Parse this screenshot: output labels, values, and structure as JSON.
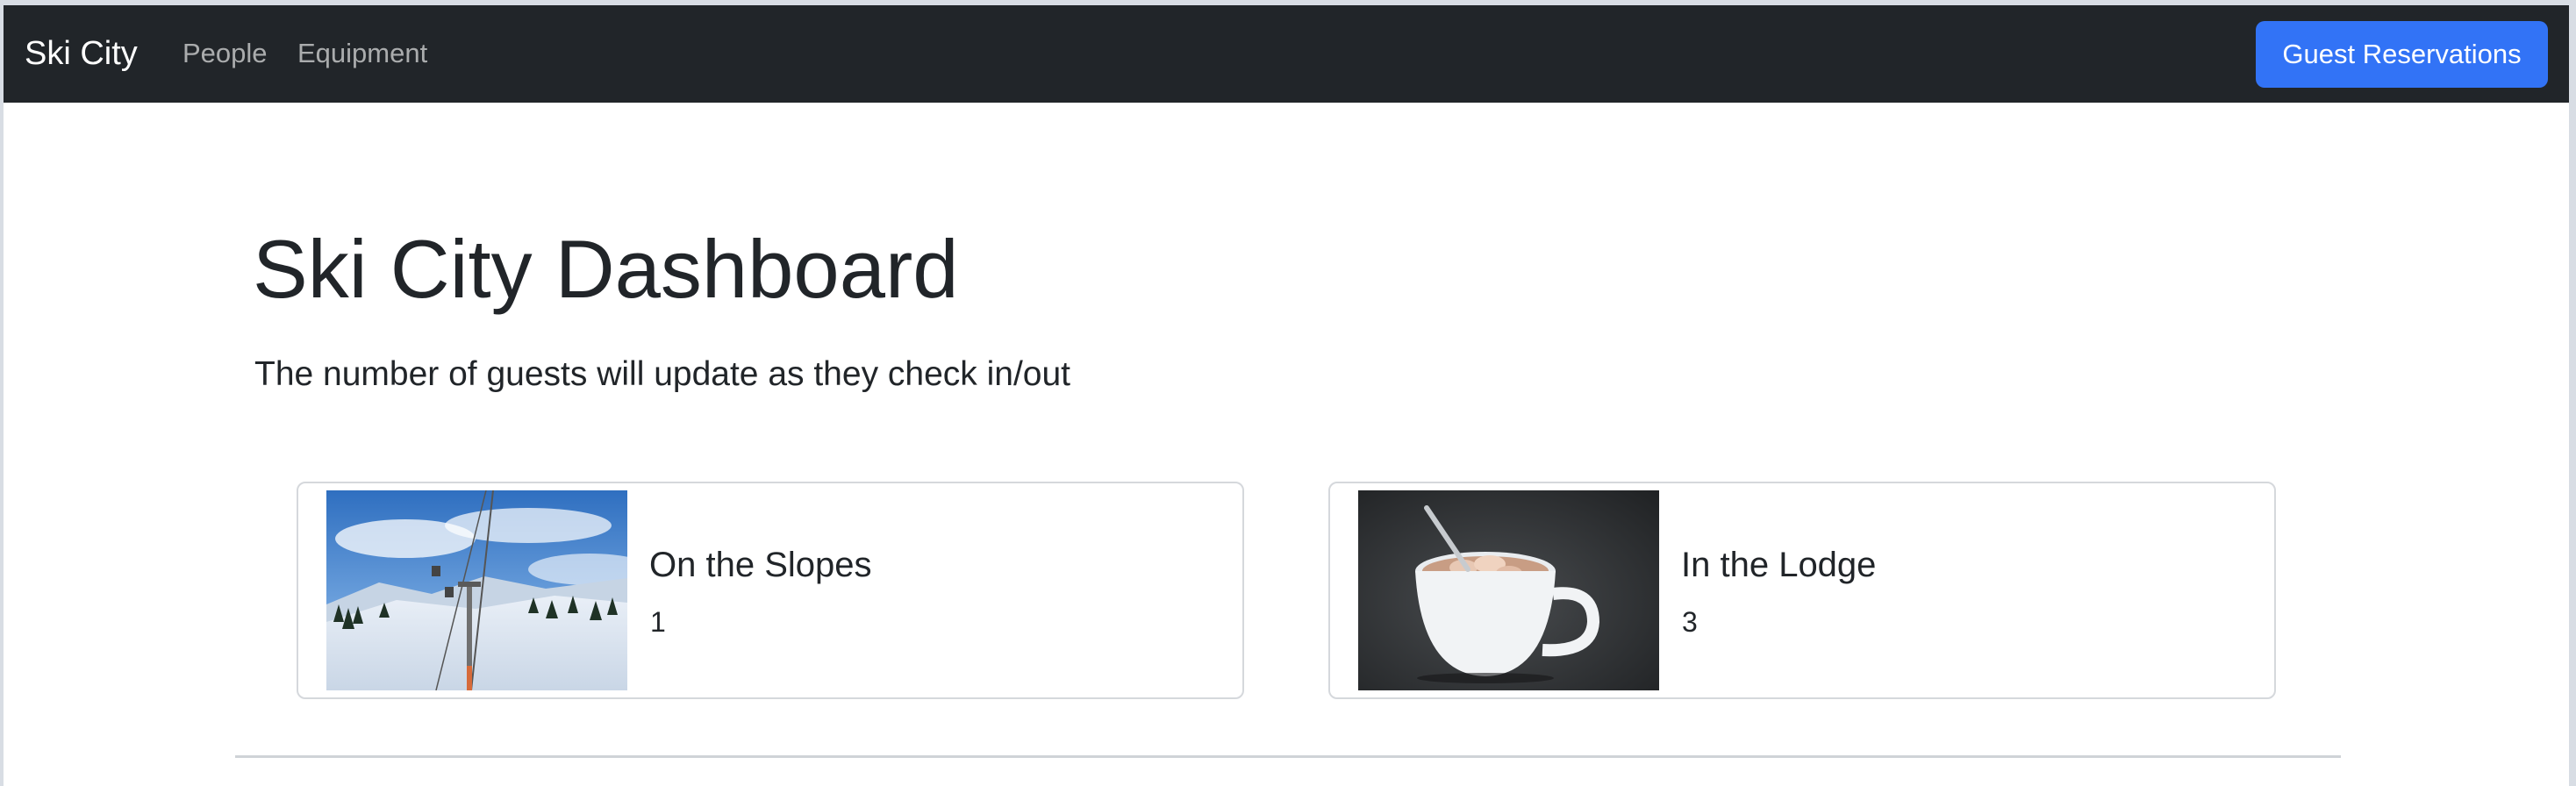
{
  "navbar": {
    "brand": "Ski City",
    "links": [
      {
        "label": "People"
      },
      {
        "label": "Equipment"
      }
    ],
    "action_label": "Guest Reservations"
  },
  "main": {
    "title": "Ski City Dashboard",
    "lead": "The number of guests will update as they check in/out",
    "cards": [
      {
        "title": "On the Slopes",
        "count": "1",
        "image": "ski-slope-photo"
      },
      {
        "title": "In the Lodge",
        "count": "3",
        "image": "hot-cocoa-photo"
      }
    ]
  },
  "colors": {
    "navbar_bg": "#212529",
    "primary": "#3273f6",
    "text": "#212529"
  }
}
